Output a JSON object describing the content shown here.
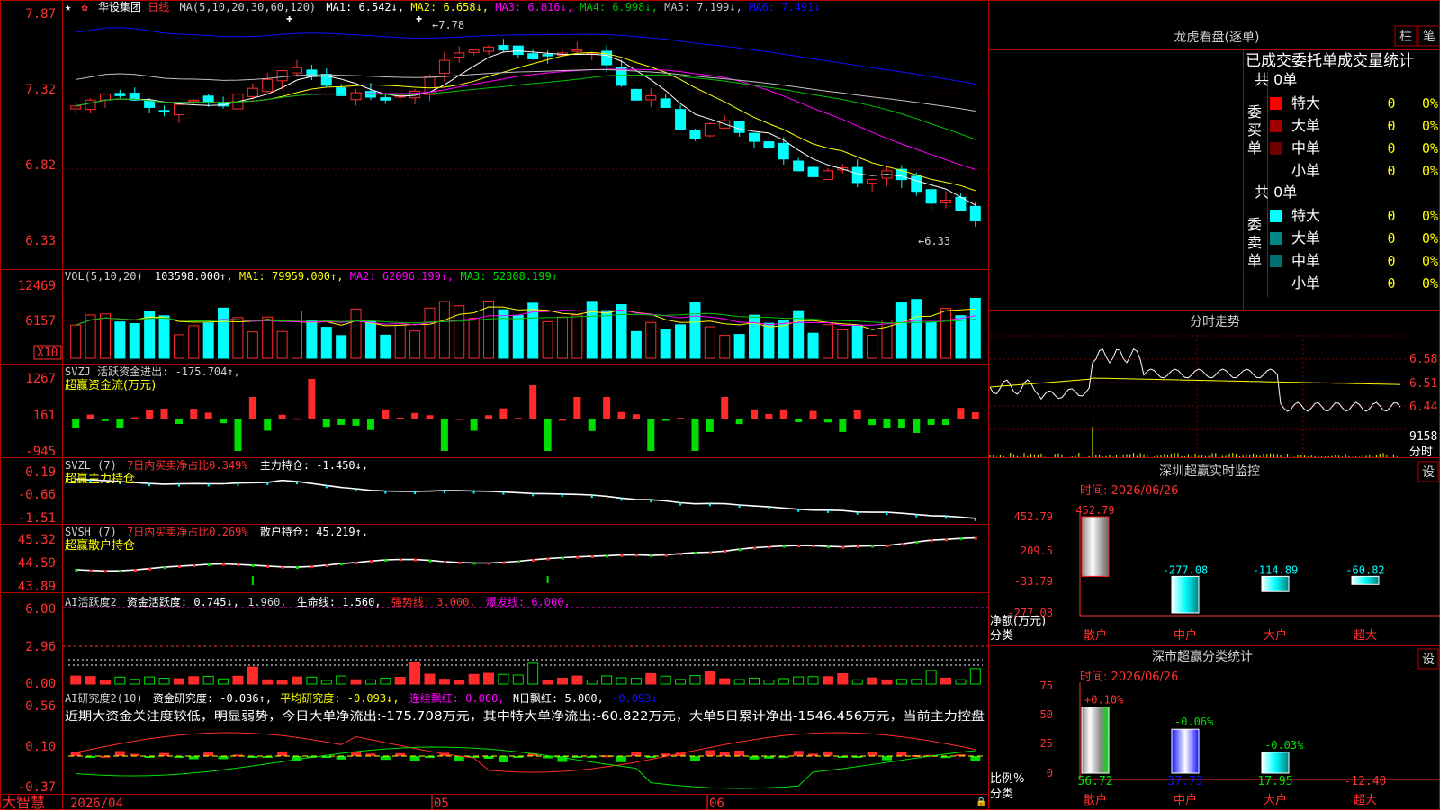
{
  "colors": {
    "up": "#ff2b2b",
    "down": "#00ffff",
    "grid": "#b00000",
    "ma1": "#ffffff",
    "ma2": "#ffff00",
    "ma3": "#ff00ff",
    "ma4": "#00c000",
    "ma5": "#c0c0c0",
    "ma6": "#1010ff",
    "green": "#00e000",
    "label": "#ffff00",
    "text": "#d0d0d0"
  },
  "header": {
    "star": "★",
    "stock_name": "华设集团",
    "period": "日线",
    "ma_spec": "MA(5,10,20,30,60,120)",
    "ma1": "MA1: 6.542↓,",
    "ma2": "MA2: 6.658↓,",
    "ma3": "MA3: 6.816↓,",
    "ma4": "MA4: 6.998↓,",
    "ma5": "MA5: 7.199↓,",
    "ma6": "MA6: 7.491↓"
  },
  "price_axis": [
    "7.87",
    "7.32",
    "6.82",
    "6.33"
  ],
  "price_annot": {
    "high": "←7.78",
    "low": "←6.33"
  },
  "vol": {
    "title": "VOL(5,10,20)",
    "value": "103598.000↑,",
    "ma1": "MA1: 79959.000↑,",
    "ma2": "MA2: 62096.199↑,",
    "ma3": "MA3: 52308.199↑",
    "axis": [
      "12469",
      "6157"
    ],
    "unit": "X10"
  },
  "svzj": {
    "title": "SVZJ  活跃资金进出: -175.704↑,",
    "subtitle": "超赢资金流(万元)",
    "axis": [
      "1267",
      "161",
      "-945"
    ]
  },
  "svzl": {
    "title": "SVZL (7)",
    "pct": "7日内买卖净占比0.349%",
    "hold": "主力持仓: -1.450↓,",
    "subtitle": "超赢主力持仓",
    "axis": [
      "0.19",
      "-0.66",
      "-1.51"
    ]
  },
  "svsh": {
    "title": "SVSH (7)",
    "pct": "7日内买卖净占比0.269%",
    "hold": "散户持仓: 45.219↑,",
    "subtitle": "超赢散户持仓",
    "axis": [
      "45.32",
      "44.59",
      "43.89"
    ]
  },
  "ai1": {
    "title": "AI活跃度2",
    "fund": "资金活跃度: 0.745↓,",
    "v2": "1.960,",
    "life": "生命线: 1.560,",
    "strong": "强势线: 3.000,",
    "burst": "爆发线: 6.000,",
    "axis": [
      "6.00",
      "2.96",
      "0.00"
    ]
  },
  "ai2": {
    "title": "AI研究度2(10)",
    "fund": "资金研究度: -0.036↑,",
    "avg": "平均研究度: -0.093↓,",
    "cont": "连续飘红: 0.000,",
    "nday": "N日飘红: 5.000,",
    "last": "-0.093↓",
    "comment": "近期大资金关注度较低，明显弱势，今日大单净流出:-175.708万元，其中特大单净流出:-60.822万元，大单5日累计净出-1546.456万元，当前主力控盘",
    "axis": [
      "0.56",
      "0.10",
      "-0.37"
    ]
  },
  "date_axis": {
    "app": "大智慧",
    "d1": "2026/04",
    "d2": "05",
    "d3": "06"
  },
  "longhu": {
    "title": "龙虎看盘(逐单)",
    "btn1": "柱",
    "btn2": "笔",
    "header": "已成交委托单成交量统计",
    "buy": {
      "side": "委买单",
      "total": "共 0单",
      "rows": [
        {
          "label": "特大",
          "v": "0",
          "p": "0%",
          "c": "#ff0000"
        },
        {
          "label": "大单",
          "v": "0",
          "p": "0%",
          "c": "#a00000"
        },
        {
          "label": "中单",
          "v": "0",
          "p": "0%",
          "c": "#700000"
        },
        {
          "label": "小单",
          "v": "0",
          "p": "0%",
          "c": ""
        }
      ]
    },
    "sell": {
      "side": "委卖单",
      "total": "共 0单",
      "rows": [
        {
          "label": "特大",
          "v": "0",
          "p": "0%",
          "c": "#00ffff"
        },
        {
          "label": "大单",
          "v": "0",
          "p": "0%",
          "c": "#008888"
        },
        {
          "label": "中单",
          "v": "0",
          "p": "0%",
          "c": "#007070"
        },
        {
          "label": "小单",
          "v": "0",
          "p": "0%",
          "c": ""
        }
      ]
    }
  },
  "intraday": {
    "title": "分时走势",
    "axis": [
      "6.58",
      "6.51",
      "6.44"
    ],
    "vol": "9158",
    "unit": "分时"
  },
  "monitor": {
    "title": "深圳超赢实时监控",
    "btn": "设",
    "date": "时间: 2026/06/26",
    "axis": [
      "452.79",
      "209.5",
      "-33.79",
      "-277.08"
    ],
    "ylabel1": "净额(万元)",
    "ylabel2": "分类",
    "cats": [
      "散户",
      "中户",
      "大户",
      "超大"
    ],
    "values": [
      452.79,
      -277.08,
      -114.89,
      -60.82
    ],
    "labels": [
      "452.79",
      "-277.08",
      "-114.89",
      "-60.82"
    ]
  },
  "classify": {
    "title": "深市超赢分类统计",
    "btn": "设",
    "date": "时间: 2026/06/26",
    "axis": [
      "75",
      "50",
      "25",
      "0"
    ],
    "ylabel1": "比例%",
    "ylabel2": "分类",
    "cats": [
      "散户",
      "中户",
      "大户",
      "超大"
    ],
    "values": [
      56.72,
      37.73,
      17.95,
      -12.4
    ],
    "vals": [
      "56.72",
      "37.73",
      "17.95",
      "-12.40"
    ],
    "chg": [
      "+0.10%",
      "-0.06%",
      "-0.03%",
      ""
    ]
  }
}
